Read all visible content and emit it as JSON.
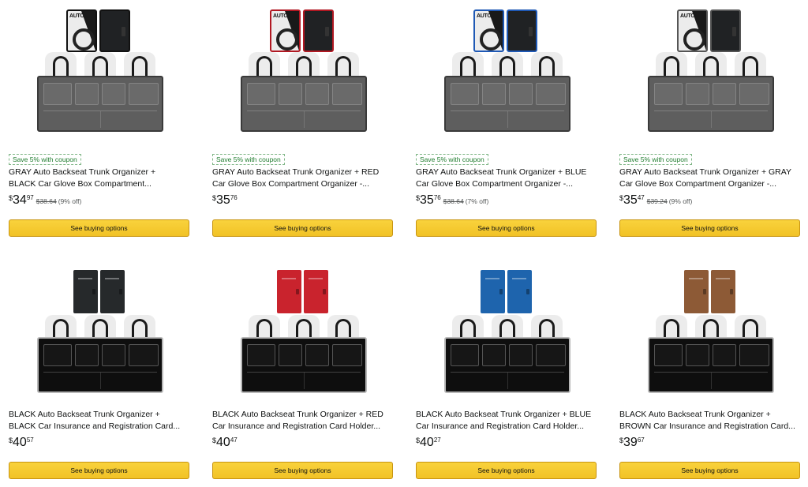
{
  "products": [
    {
      "organizer": "gray",
      "folder_type": "glove-box",
      "folder_accent": "black",
      "coupon": "Save 5% with coupon",
      "title_line1": "GRAY Auto Backseat Trunk Organizer +",
      "title_line2": "BLACK Car Glove Box Compartment...",
      "price_symbol": "$",
      "price_whole": "34",
      "price_fraction": "97",
      "list_price": "$38.64",
      "discount": "(9% off)",
      "button_label": "See buying options"
    },
    {
      "organizer": "gray",
      "folder_type": "glove-box",
      "folder_accent": "red",
      "coupon": "Save 5% with coupon",
      "title_line1": "GRAY Auto Backseat Trunk Organizer + RED",
      "title_line2": "Car Glove Box Compartment Organizer -...",
      "price_symbol": "$",
      "price_whole": "35",
      "price_fraction": "76",
      "list_price": "",
      "discount": "",
      "button_label": "See buying options"
    },
    {
      "organizer": "gray",
      "folder_type": "glove-box",
      "folder_accent": "blue",
      "coupon": "Save 5% with coupon",
      "title_line1": "GRAY Auto Backseat Trunk Organizer + BLUE",
      "title_line2": "Car Glove Box Compartment Organizer -...",
      "price_symbol": "$",
      "price_whole": "35",
      "price_fraction": "76",
      "list_price": "$38.64",
      "discount": "(7% off)",
      "button_label": "See buying options"
    },
    {
      "organizer": "gray",
      "folder_type": "glove-box",
      "folder_accent": "gray",
      "coupon": "Save 5% with coupon",
      "title_line1": "GRAY Auto Backseat Trunk Organizer + GRAY",
      "title_line2": "Car Glove Box Compartment Organizer -...",
      "price_symbol": "$",
      "price_whole": "35",
      "price_fraction": "47",
      "list_price": "$39.24",
      "discount": "(9% off)",
      "button_label": "See buying options"
    },
    {
      "organizer": "black",
      "folder_type": "insurance",
      "folder_accent": "black",
      "coupon": "",
      "title_line1": "BLACK Auto Backseat Trunk Organizer +",
      "title_line2": "BLACK Car Insurance and Registration Card...",
      "price_symbol": "$",
      "price_whole": "40",
      "price_fraction": "57",
      "list_price": "",
      "discount": "",
      "button_label": "See buying options"
    },
    {
      "organizer": "black",
      "folder_type": "insurance",
      "folder_accent": "red",
      "coupon": "",
      "title_line1": "BLACK Auto Backseat Trunk Organizer + RED",
      "title_line2": "Car Insurance and Registration Card Holder...",
      "price_symbol": "$",
      "price_whole": "40",
      "price_fraction": "47",
      "list_price": "",
      "discount": "",
      "button_label": "See buying options"
    },
    {
      "organizer": "black",
      "folder_type": "insurance",
      "folder_accent": "blue",
      "coupon": "",
      "title_line1": "BLACK Auto Backseat Trunk Organizer + BLUE",
      "title_line2": "Car Insurance and Registration Card Holder...",
      "price_symbol": "$",
      "price_whole": "40",
      "price_fraction": "27",
      "list_price": "",
      "discount": "",
      "button_label": "See buying options"
    },
    {
      "organizer": "black",
      "folder_type": "insurance",
      "folder_accent": "brown",
      "coupon": "",
      "title_line1": "BLACK Auto Backseat Trunk Organizer +",
      "title_line2": "BROWN Car Insurance and Registration Card...",
      "price_symbol": "$",
      "price_whole": "39",
      "price_fraction": "67",
      "list_price": "",
      "discount": "",
      "button_label": "See buying options"
    }
  ],
  "colors": {
    "button": "#f7ca00",
    "coupon_green": "#207d2f",
    "text": "#0f1111",
    "muted": "#565959"
  }
}
